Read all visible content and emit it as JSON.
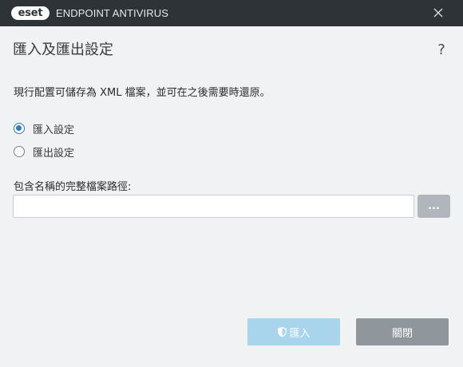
{
  "titlebar": {
    "logo_text": "eset",
    "product_name": "ENDPOINT ANTIVIRUS",
    "close_icon": "close-icon"
  },
  "dialog": {
    "title": "匯入及匯出設定",
    "help_label": "?",
    "description": "現行配置可儲存為 XML 檔案，並可在之後需要時還原。"
  },
  "options": [
    {
      "label": "匯入設定",
      "checked": true
    },
    {
      "label": "匯出設定",
      "checked": false
    }
  ],
  "path": {
    "label": "包含名稱的完整檔案路徑:",
    "value": "",
    "browse_label": "..."
  },
  "buttons": {
    "import_label": "匯入",
    "import_icon": "shield-icon",
    "close_label": "關閉"
  },
  "colors": {
    "titlebar": "#2e3338",
    "accent": "#2f7fb5",
    "import_button": "#a8d4ec",
    "close_button": "#8f969c"
  }
}
